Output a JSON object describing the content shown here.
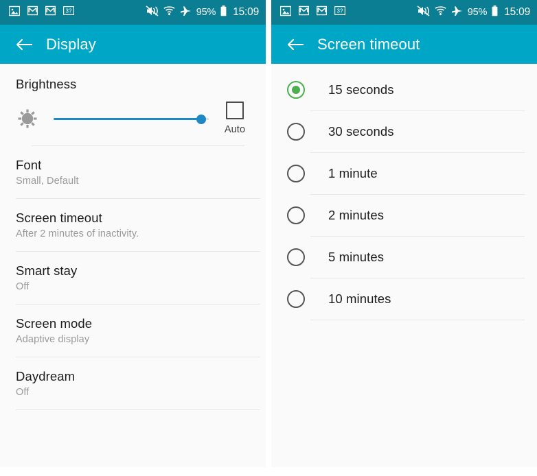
{
  "status_bar": {
    "left_icons": [
      "image-icon",
      "gmail-icon",
      "gmail-icon",
      "sd-card-icon"
    ],
    "right_icons": [
      "mute-vibrate-icon",
      "wifi-icon",
      "airplane-mode-icon"
    ],
    "battery_percent": "95%",
    "battery_icon": "battery-full-icon",
    "clock": "15:09",
    "background_color": "#0C7E93",
    "text_color": "#FFFFFF"
  },
  "accent": {
    "action_bar": "#00A6C6",
    "slider": "#1E88C7",
    "radio_selected": "#4CAF50"
  },
  "left_panel": {
    "action_bar": {
      "back_icon": "arrow-left-icon",
      "title": "Display"
    },
    "brightness": {
      "label": "Brightness",
      "sun_icon": "brightness-sun-icon",
      "slider_value": 95,
      "auto_label": "Auto",
      "auto_checked": false
    },
    "items": [
      {
        "title": "Font",
        "subtitle": "Small, Default"
      },
      {
        "title": "Screen timeout",
        "subtitle": "After 2 minutes of inactivity."
      },
      {
        "title": "Smart stay",
        "subtitle": "Off"
      },
      {
        "title": "Screen mode",
        "subtitle": "Adaptive display"
      },
      {
        "title": "Daydream",
        "subtitle": "Off"
      }
    ]
  },
  "right_panel": {
    "action_bar": {
      "back_icon": "arrow-left-icon",
      "title": "Screen timeout"
    },
    "options": [
      {
        "label": "15 seconds",
        "selected": true
      },
      {
        "label": "30 seconds",
        "selected": false
      },
      {
        "label": "1 minute",
        "selected": false
      },
      {
        "label": "2 minutes",
        "selected": false
      },
      {
        "label": "5 minutes",
        "selected": false
      },
      {
        "label": "10 minutes",
        "selected": false
      }
    ]
  }
}
